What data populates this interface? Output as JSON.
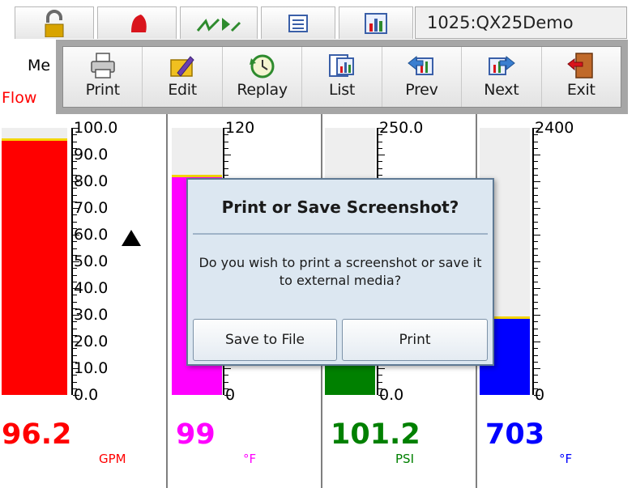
{
  "window": {
    "title": "1025:QX25Demo"
  },
  "tabs": [
    {
      "icon": "lock-icon"
    },
    {
      "icon": "alarm-bell-icon"
    },
    {
      "icon": "trend-arrows-icon"
    },
    {
      "icon": "list-view-icon"
    },
    {
      "icon": "bar-graph-icon"
    }
  ],
  "partial_labels": {
    "menu": "Me",
    "flow": "Flow"
  },
  "toolbar": {
    "buttons": [
      {
        "label": "Print",
        "icon": "printer-icon"
      },
      {
        "label": "Edit",
        "icon": "pencil-folder-icon"
      },
      {
        "label": "Replay",
        "icon": "replay-clock-icon"
      },
      {
        "label": "List",
        "icon": "list-chart-icon"
      },
      {
        "label": "Prev",
        "icon": "prev-arrow-icon"
      },
      {
        "label": "Next",
        "icon": "next-arrow-icon"
      },
      {
        "label": "Exit",
        "icon": "exit-door-icon"
      }
    ]
  },
  "channels": [
    {
      "value": "96.2",
      "unit": "GPM",
      "color": "#ff0000",
      "scale_max": 100,
      "level": 0.962,
      "scale_labels": [
        "100.0",
        "90.0",
        "80.0",
        "70.0",
        "60.0",
        "50.0",
        "40.0",
        "30.0",
        "20.0",
        "10.0",
        "0.0"
      ],
      "alarm_marker": "alarm-setpoint-icon"
    },
    {
      "value": "99",
      "unit": "°F",
      "color": "#ff00ff",
      "scale_max": 120,
      "level": 0.825,
      "scale_labels": [
        "120",
        "0"
      ]
    },
    {
      "value": "101.2",
      "unit": "PSI",
      "color": "#008000",
      "scale_max": 250,
      "level": 0.405,
      "scale_labels": [
        "250.0",
        "0.0"
      ]
    },
    {
      "value": "703",
      "unit": "°F",
      "color": "#0000ff",
      "scale_max": 2400,
      "level": 0.293,
      "scale_labels": [
        "2400",
        "0"
      ]
    }
  ],
  "dialog": {
    "title": "Print or Save Screenshot?",
    "message": "Do you wish to print a screenshot or save it to external media?",
    "save_button": "Save to File",
    "print_button": "Print"
  }
}
